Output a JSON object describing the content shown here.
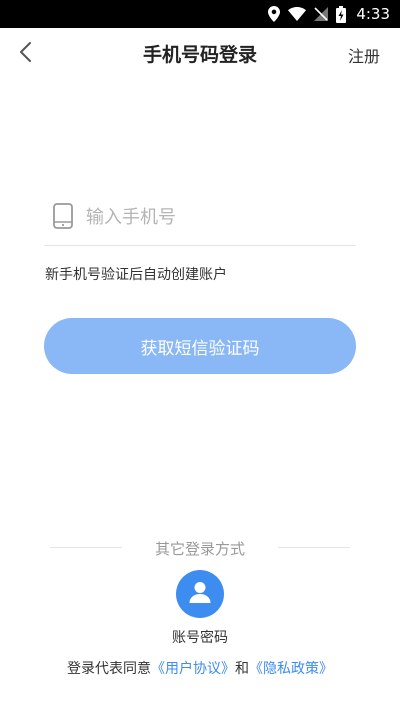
{
  "status_bar": {
    "time": "4:33",
    "icons": [
      "location-icon",
      "wifi-icon",
      "no-signal-icon",
      "battery-charging-icon"
    ]
  },
  "header": {
    "back_icon": "chevron-left-icon",
    "title": "手机号码登录",
    "register_label": "注册"
  },
  "phone_field": {
    "icon": "phone-icon",
    "placeholder": "输入手机号",
    "value": ""
  },
  "hint": "新手机号验证后自动创建账户",
  "sms_button_label": "获取短信验证码",
  "other_login": {
    "title": "其它登录方式",
    "account_icon": "user-icon",
    "account_label": "账号密码"
  },
  "agreement": {
    "prefix": "登录代表同意",
    "user_agreement": "《用户协议》",
    "conjunction": "和",
    "privacy_policy": "《隐私政策》"
  },
  "colors": {
    "accent": "#3d8cf0",
    "button_disabled": "#8ab8f7",
    "status_bar": "#000000"
  }
}
